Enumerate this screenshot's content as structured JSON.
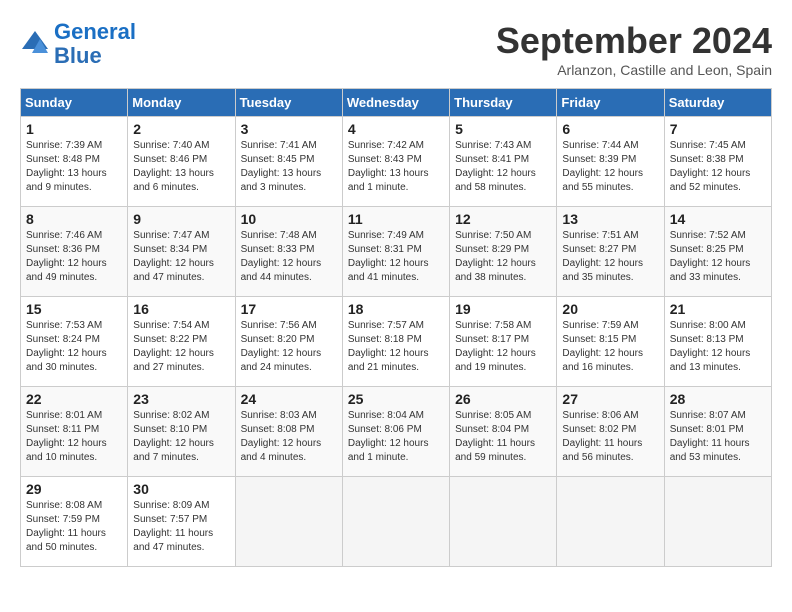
{
  "header": {
    "logo_line1": "General",
    "logo_line2": "Blue",
    "month": "September 2024",
    "location": "Arlanzon, Castille and Leon, Spain"
  },
  "weekdays": [
    "Sunday",
    "Monday",
    "Tuesday",
    "Wednesday",
    "Thursday",
    "Friday",
    "Saturday"
  ],
  "weeks": [
    [
      {
        "day": 1,
        "info": "Sunrise: 7:39 AM\nSunset: 8:48 PM\nDaylight: 13 hours\nand 9 minutes."
      },
      {
        "day": 2,
        "info": "Sunrise: 7:40 AM\nSunset: 8:46 PM\nDaylight: 13 hours\nand 6 minutes."
      },
      {
        "day": 3,
        "info": "Sunrise: 7:41 AM\nSunset: 8:45 PM\nDaylight: 13 hours\nand 3 minutes."
      },
      {
        "day": 4,
        "info": "Sunrise: 7:42 AM\nSunset: 8:43 PM\nDaylight: 13 hours\nand 1 minute."
      },
      {
        "day": 5,
        "info": "Sunrise: 7:43 AM\nSunset: 8:41 PM\nDaylight: 12 hours\nand 58 minutes."
      },
      {
        "day": 6,
        "info": "Sunrise: 7:44 AM\nSunset: 8:39 PM\nDaylight: 12 hours\nand 55 minutes."
      },
      {
        "day": 7,
        "info": "Sunrise: 7:45 AM\nSunset: 8:38 PM\nDaylight: 12 hours\nand 52 minutes."
      }
    ],
    [
      {
        "day": 8,
        "info": "Sunrise: 7:46 AM\nSunset: 8:36 PM\nDaylight: 12 hours\nand 49 minutes."
      },
      {
        "day": 9,
        "info": "Sunrise: 7:47 AM\nSunset: 8:34 PM\nDaylight: 12 hours\nand 47 minutes."
      },
      {
        "day": 10,
        "info": "Sunrise: 7:48 AM\nSunset: 8:33 PM\nDaylight: 12 hours\nand 44 minutes."
      },
      {
        "day": 11,
        "info": "Sunrise: 7:49 AM\nSunset: 8:31 PM\nDaylight: 12 hours\nand 41 minutes."
      },
      {
        "day": 12,
        "info": "Sunrise: 7:50 AM\nSunset: 8:29 PM\nDaylight: 12 hours\nand 38 minutes."
      },
      {
        "day": 13,
        "info": "Sunrise: 7:51 AM\nSunset: 8:27 PM\nDaylight: 12 hours\nand 35 minutes."
      },
      {
        "day": 14,
        "info": "Sunrise: 7:52 AM\nSunset: 8:25 PM\nDaylight: 12 hours\nand 33 minutes."
      }
    ],
    [
      {
        "day": 15,
        "info": "Sunrise: 7:53 AM\nSunset: 8:24 PM\nDaylight: 12 hours\nand 30 minutes."
      },
      {
        "day": 16,
        "info": "Sunrise: 7:54 AM\nSunset: 8:22 PM\nDaylight: 12 hours\nand 27 minutes."
      },
      {
        "day": 17,
        "info": "Sunrise: 7:56 AM\nSunset: 8:20 PM\nDaylight: 12 hours\nand 24 minutes."
      },
      {
        "day": 18,
        "info": "Sunrise: 7:57 AM\nSunset: 8:18 PM\nDaylight: 12 hours\nand 21 minutes."
      },
      {
        "day": 19,
        "info": "Sunrise: 7:58 AM\nSunset: 8:17 PM\nDaylight: 12 hours\nand 19 minutes."
      },
      {
        "day": 20,
        "info": "Sunrise: 7:59 AM\nSunset: 8:15 PM\nDaylight: 12 hours\nand 16 minutes."
      },
      {
        "day": 21,
        "info": "Sunrise: 8:00 AM\nSunset: 8:13 PM\nDaylight: 12 hours\nand 13 minutes."
      }
    ],
    [
      {
        "day": 22,
        "info": "Sunrise: 8:01 AM\nSunset: 8:11 PM\nDaylight: 12 hours\nand 10 minutes."
      },
      {
        "day": 23,
        "info": "Sunrise: 8:02 AM\nSunset: 8:10 PM\nDaylight: 12 hours\nand 7 minutes."
      },
      {
        "day": 24,
        "info": "Sunrise: 8:03 AM\nSunset: 8:08 PM\nDaylight: 12 hours\nand 4 minutes."
      },
      {
        "day": 25,
        "info": "Sunrise: 8:04 AM\nSunset: 8:06 PM\nDaylight: 12 hours\nand 1 minute."
      },
      {
        "day": 26,
        "info": "Sunrise: 8:05 AM\nSunset: 8:04 PM\nDaylight: 11 hours\nand 59 minutes."
      },
      {
        "day": 27,
        "info": "Sunrise: 8:06 AM\nSunset: 8:02 PM\nDaylight: 11 hours\nand 56 minutes."
      },
      {
        "day": 28,
        "info": "Sunrise: 8:07 AM\nSunset: 8:01 PM\nDaylight: 11 hours\nand 53 minutes."
      }
    ],
    [
      {
        "day": 29,
        "info": "Sunrise: 8:08 AM\nSunset: 7:59 PM\nDaylight: 11 hours\nand 50 minutes."
      },
      {
        "day": 30,
        "info": "Sunrise: 8:09 AM\nSunset: 7:57 PM\nDaylight: 11 hours\nand 47 minutes."
      },
      null,
      null,
      null,
      null,
      null
    ]
  ]
}
